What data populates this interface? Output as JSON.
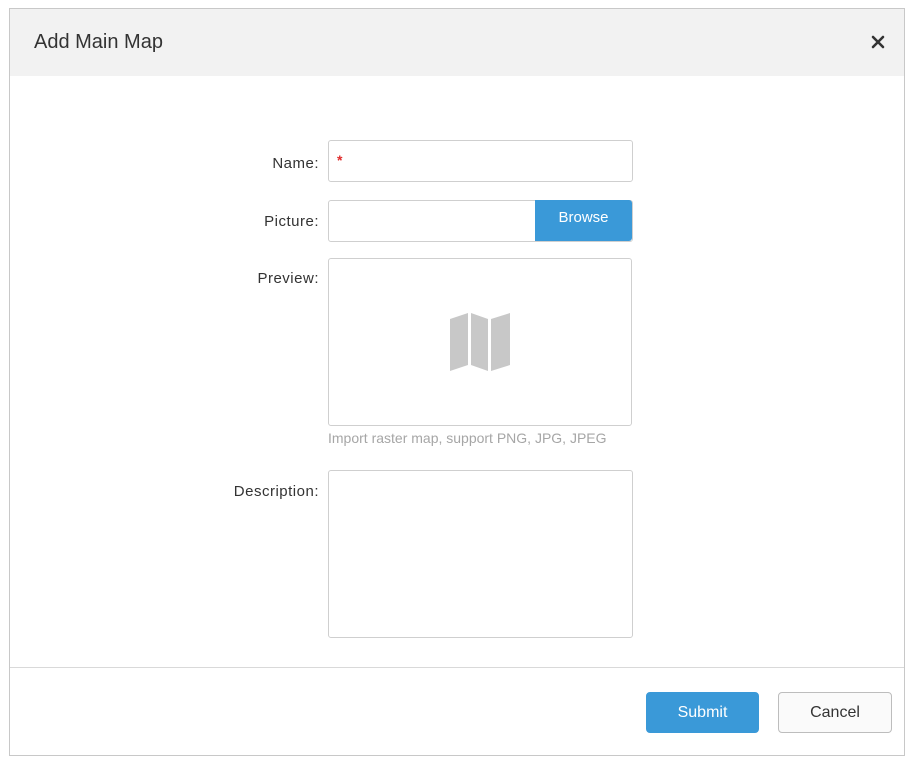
{
  "dialog": {
    "title": "Add Main Map",
    "close_icon": "close-icon"
  },
  "form": {
    "name": {
      "label": "Name:",
      "value": "",
      "required_mark": "*"
    },
    "picture": {
      "label": "Picture:",
      "value": "",
      "browse_label": "Browse"
    },
    "preview": {
      "label": "Preview:",
      "icon": "map-icon",
      "hint": "Import raster map, support PNG, JPG, JPEG"
    },
    "description": {
      "label": "Description:",
      "value": ""
    }
  },
  "footer": {
    "submit_label": "Submit",
    "cancel_label": "Cancel"
  },
  "colors": {
    "accent": "#3a99d8",
    "required": "#e02b2b",
    "header_bg": "#f2f2f2"
  }
}
